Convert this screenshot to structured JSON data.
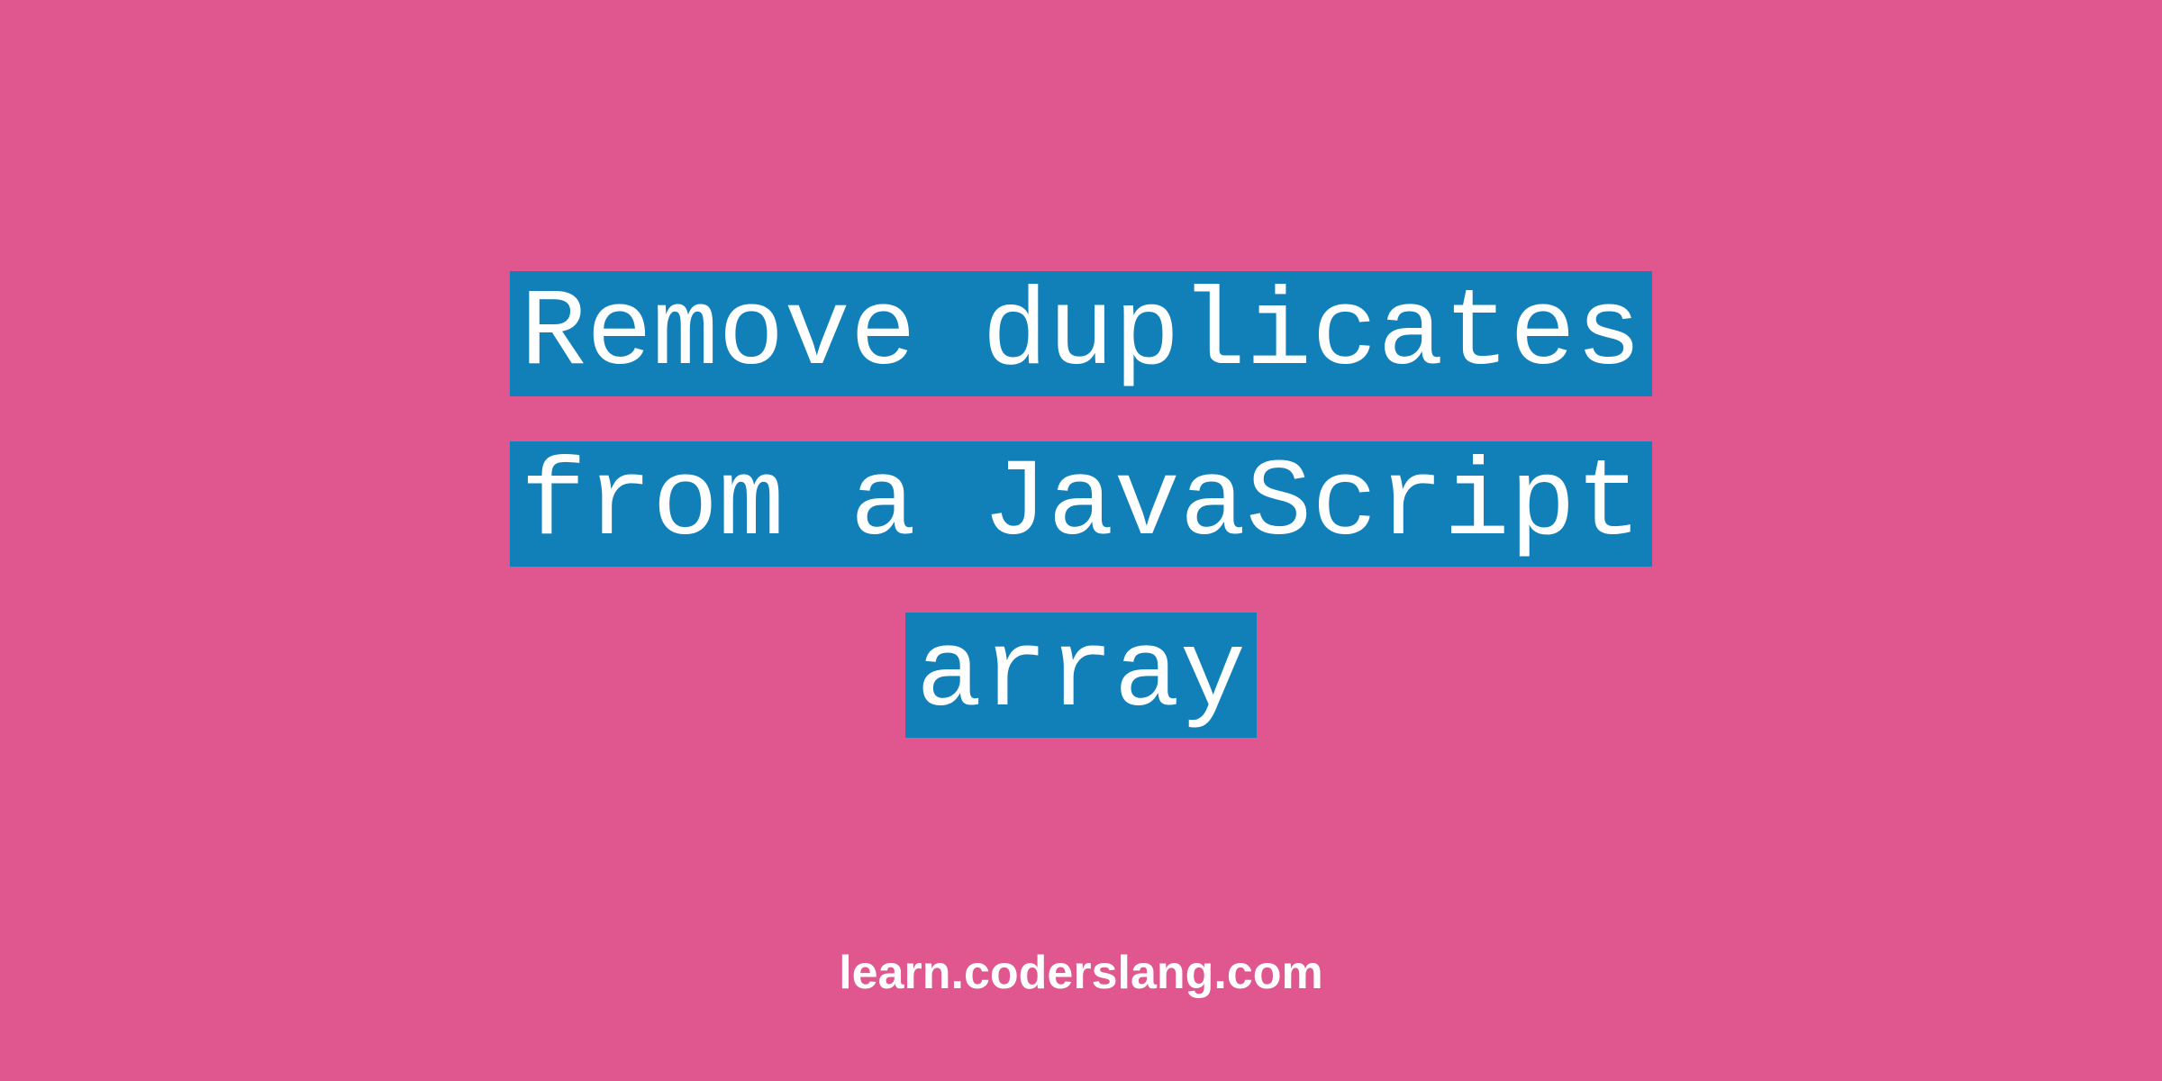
{
  "title": {
    "line1": "Remove duplicates",
    "line2": "from a JavaScript",
    "line3": "array"
  },
  "footer": "learn.coderslang.com",
  "colors": {
    "background": "#e0568f",
    "highlight": "#1280b8",
    "text": "#ffffff"
  }
}
